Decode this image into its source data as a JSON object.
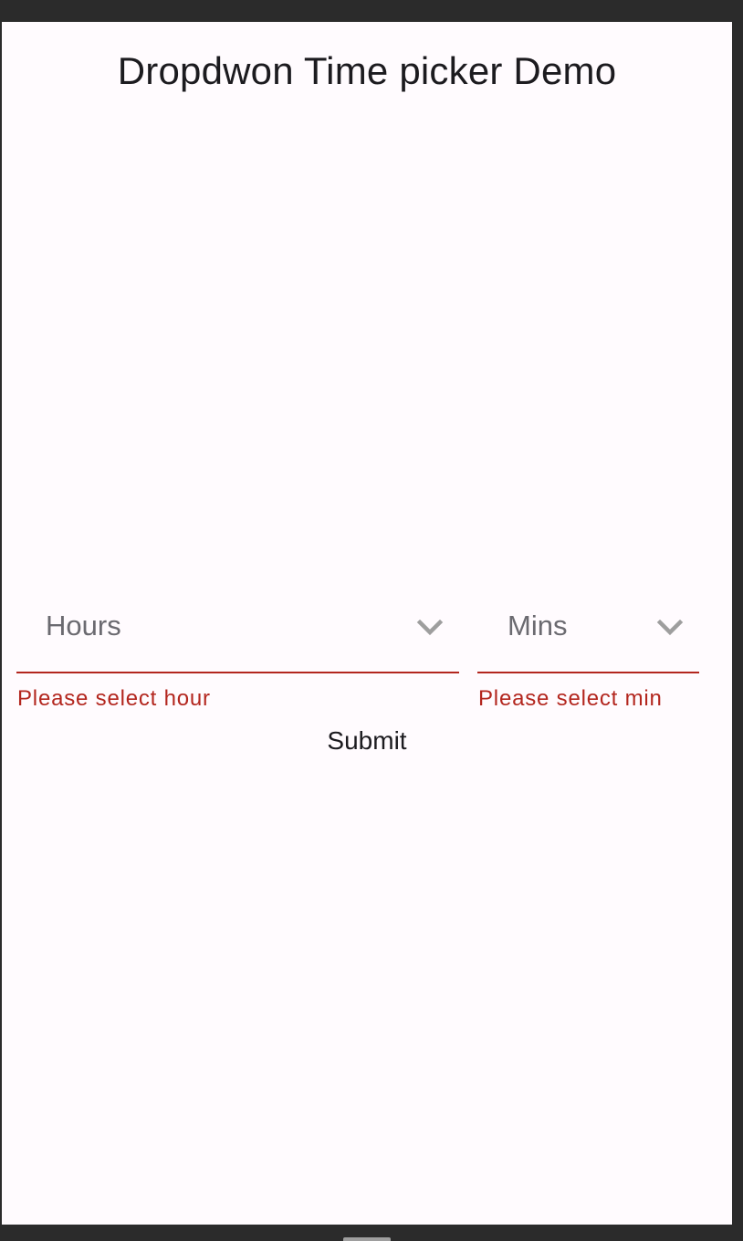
{
  "app_bar": {
    "title": "Dropdwon Time picker Demo"
  },
  "form": {
    "hours": {
      "label": "Hours",
      "icon": "chevron-down-icon",
      "error": "Please select hour"
    },
    "mins": {
      "label": "Mins",
      "icon": "chevron-down-icon",
      "error": "Please select min"
    },
    "submit_label": "Submit"
  },
  "colors": {
    "background": "#fffbfe",
    "frame": "#2b2b2b",
    "error": "#b3261e",
    "text": "#1c1b1f",
    "label": "#6b6a70",
    "icon": "#9e9e9e"
  }
}
